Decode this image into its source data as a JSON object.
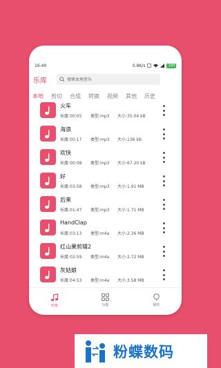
{
  "status": {
    "time": "16:40",
    "network_speed": "0.8K/s",
    "battery": "100"
  },
  "header": {
    "title": "乐库",
    "search_placeholder": "搜索本地音乐"
  },
  "tabs": [
    {
      "label": "本地",
      "active": true
    },
    {
      "label": "剪切",
      "active": false
    },
    {
      "label": "合成",
      "active": false
    },
    {
      "label": "转换",
      "active": false
    },
    {
      "label": "视频",
      "active": false
    },
    {
      "label": "其他",
      "active": false
    },
    {
      "label": "历史",
      "active": false
    }
  ],
  "songs": [
    {
      "title": "火车",
      "length": "长度:00:05",
      "type": "类型:mp3",
      "size": "大小:35.04 kB"
    },
    {
      "title": "海浪",
      "length": "长度:00:17",
      "type": "类型:mp3",
      "size": "大小:136 kB"
    },
    {
      "title": "欢快",
      "length": "长度:00:08",
      "type": "类型:mp3",
      "size": "大小:67.20 kB"
    },
    {
      "title": "好",
      "length": "长度:03:58",
      "type": "类型:mp3",
      "size": "大小:1.91 MB"
    },
    {
      "title": "后来",
      "length": "长度:01:47",
      "type": "类型:mp3",
      "size": "大小:1.71 MB"
    },
    {
      "title": "HandClap",
      "length": "长度:03:13",
      "type": "类型:m4a",
      "size": "大小:2.36 MB"
    },
    {
      "title": "红山果剪辑2",
      "length": "长度:02:59",
      "type": "类型:m4a",
      "size": "大小:2.72 MB"
    },
    {
      "title": "灰姑娘",
      "length": "长度:04:53",
      "type": "类型:m4a",
      "size": "大小:3.58 MB"
    }
  ],
  "bottom_nav": [
    {
      "label": "乐库",
      "icon": "music-note-icon",
      "active": true
    },
    {
      "label": "功能",
      "icon": "grid-icon",
      "active": false
    },
    {
      "label": "我的",
      "icon": "person-icon",
      "active": false
    }
  ],
  "brand": {
    "text": "粉蝶数码"
  },
  "colors": {
    "accent": "#e84f6c",
    "brand_blue": "#1a73c9"
  }
}
